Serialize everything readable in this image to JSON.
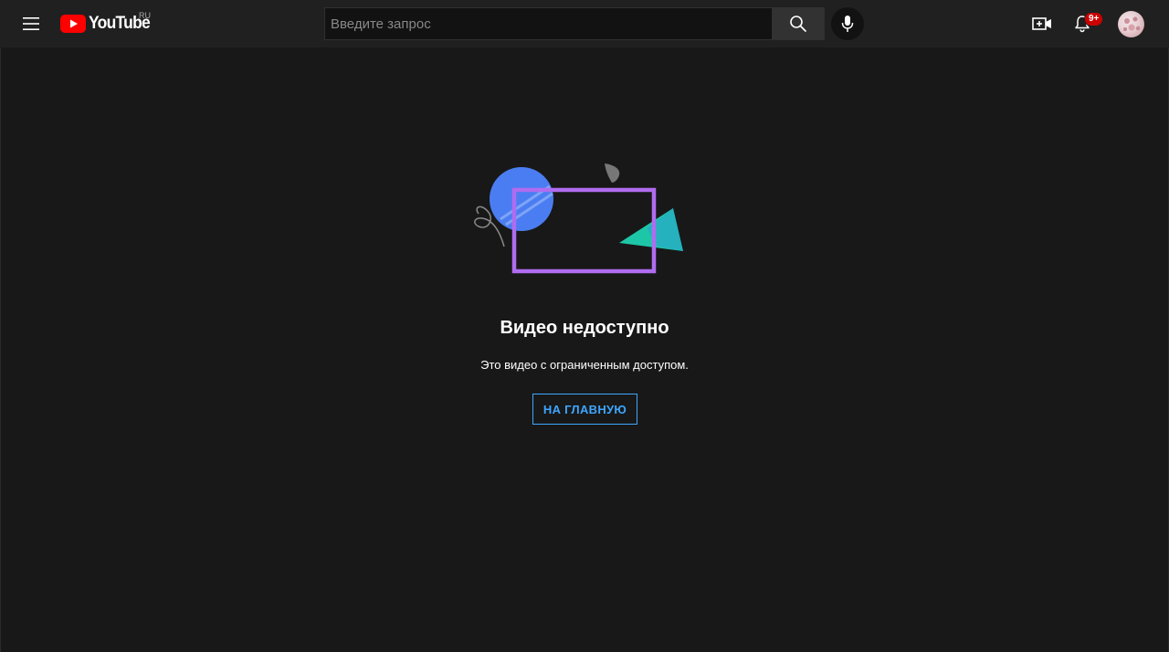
{
  "header": {
    "logo_text": "YouTube",
    "country_code": "RU",
    "search_placeholder": "Введите запрос",
    "search_value": "",
    "notifications_badge": "9+"
  },
  "icons": {
    "menu": "hamburger-menu-icon",
    "search": "search-icon",
    "mic": "microphone-icon",
    "create": "video-camera-plus-icon",
    "notifications": "bell-icon"
  },
  "colors": {
    "background": "#181818",
    "header": "#202020",
    "accent_blue": "#3ea6ff",
    "youtube_red": "#ff0000",
    "badge_red": "#cc0000",
    "frame_purple": "#b06cf0",
    "circle_blue": "#4b7df2",
    "triangle_teal": "#1ec6a8"
  },
  "error": {
    "title": "Видео недоступно",
    "message": "Это видео с ограниченным доступом.",
    "home_button": "НА ГЛАВНУЮ"
  }
}
